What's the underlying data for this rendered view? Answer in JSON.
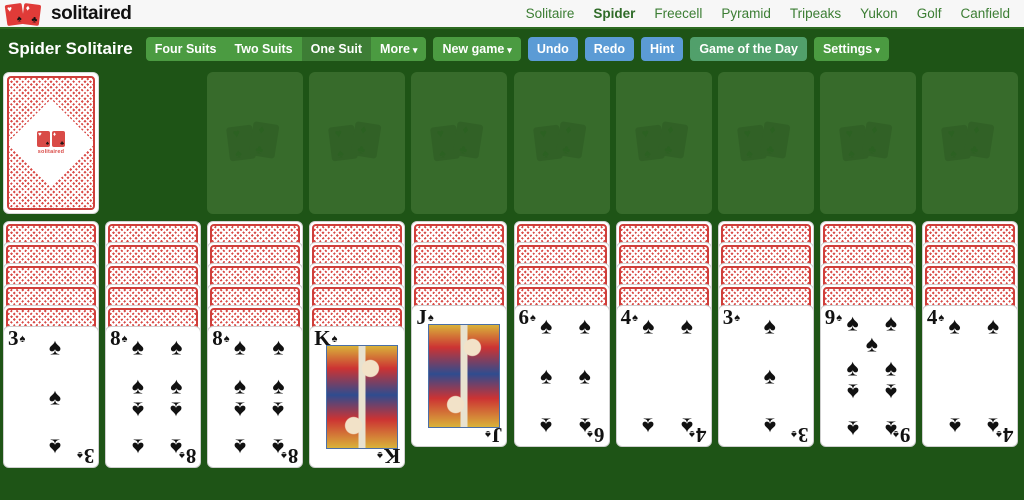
{
  "topbar": {
    "brand": "solitaired",
    "logo_icon": "two-playing-cards-icon",
    "nav": [
      {
        "label": "Solitaire",
        "active": false
      },
      {
        "label": "Spider",
        "active": true
      },
      {
        "label": "Freecell",
        "active": false
      },
      {
        "label": "Pyramid",
        "active": false
      },
      {
        "label": "Tripeaks",
        "active": false
      },
      {
        "label": "Yukon",
        "active": false
      },
      {
        "label": "Golf",
        "active": false
      },
      {
        "label": "Canfield",
        "active": false
      }
    ]
  },
  "toolbar": {
    "title": "Spider Solitaire",
    "difficulty": [
      {
        "label": "Four Suits",
        "state": "normal"
      },
      {
        "label": "Two Suits",
        "state": "normal"
      },
      {
        "label": "One Suit",
        "state": "active"
      },
      {
        "label": "More",
        "state": "dropdown"
      }
    ],
    "new_game_label": "New game",
    "undo_label": "Undo",
    "redo_label": "Redo",
    "hint_label": "Hint",
    "game_of_day_label": "Game of the Day",
    "settings_label": "Settings",
    "caret_glyph": "▾"
  },
  "colors": {
    "felt": "#1e5416",
    "slot": "#376b2b",
    "green_button": "#4b9b41",
    "green_button_active": "#3d7d35",
    "blue_button": "#5b9bd5",
    "teal_button": "#51a06b",
    "card_red": "#d94b47",
    "nav_link": "#3b7d33"
  },
  "board": {
    "stock": {
      "name": "stock-pile",
      "face_down": true,
      "back_label": "solitaired",
      "pips": [
        "♥",
        "♠",
        "♦",
        "♣"
      ]
    },
    "foundations": [
      {
        "index": 1,
        "empty": true
      },
      {
        "index": 2,
        "empty": true
      },
      {
        "index": 3,
        "empty": true
      },
      {
        "index": 4,
        "empty": true
      },
      {
        "index": 5,
        "empty": true
      },
      {
        "index": 6,
        "empty": true
      },
      {
        "index": 7,
        "empty": true
      },
      {
        "index": 8,
        "empty": true
      }
    ],
    "foundation_placeholder_pips": [
      "♥",
      "♠",
      "♦",
      "♣"
    ],
    "tableau": [
      {
        "index": 1,
        "face_down": 5,
        "top_card": {
          "rank": "3",
          "suit": "♠",
          "type": "number",
          "count": 3
        }
      },
      {
        "index": 2,
        "face_down": 5,
        "top_card": {
          "rank": "8",
          "suit": "♠",
          "type": "number",
          "count": 8
        }
      },
      {
        "index": 3,
        "face_down": 5,
        "top_card": {
          "rank": "8",
          "suit": "♠",
          "type": "number",
          "count": 8
        }
      },
      {
        "index": 4,
        "face_down": 5,
        "top_card": {
          "rank": "K",
          "suit": "♠",
          "type": "court",
          "count": 0
        }
      },
      {
        "index": 5,
        "face_down": 4,
        "top_card": {
          "rank": "J",
          "suit": "♠",
          "type": "court",
          "count": 0
        }
      },
      {
        "index": 6,
        "face_down": 4,
        "top_card": {
          "rank": "6",
          "suit": "♠",
          "type": "number",
          "count": 6
        }
      },
      {
        "index": 7,
        "face_down": 4,
        "top_card": {
          "rank": "4",
          "suit": "♠",
          "type": "number",
          "count": 4
        }
      },
      {
        "index": 8,
        "face_down": 4,
        "top_card": {
          "rank": "3",
          "suit": "♠",
          "type": "number",
          "count": 3
        }
      },
      {
        "index": 9,
        "face_down": 4,
        "top_card": {
          "rank": "9",
          "suit": "♠",
          "type": "number",
          "count": 9
        }
      },
      {
        "index": 10,
        "face_down": 4,
        "top_card": {
          "rank": "4",
          "suit": "♠",
          "type": "number",
          "count": 4
        }
      }
    ]
  }
}
